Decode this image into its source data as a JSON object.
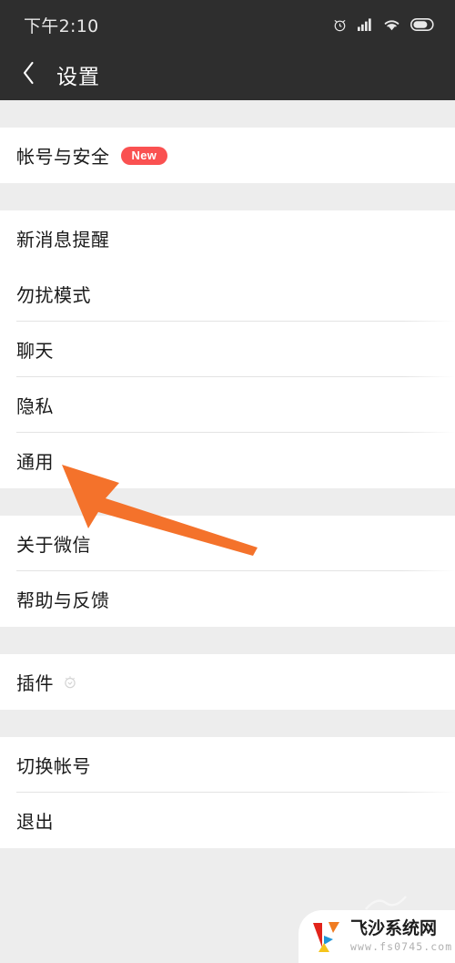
{
  "status_bar": {
    "time": "下午2:10",
    "icons": [
      "alarm-icon",
      "signal-icon",
      "wifi-icon",
      "battery-icon"
    ],
    "background_color": "#2e2e2e",
    "text_color": "#e8e8e8"
  },
  "header": {
    "back_icon": "chevron-left-icon",
    "title": "设置",
    "background_color": "#2e2e2e",
    "title_color": "#ffffff"
  },
  "colors": {
    "page_background": "#ededed",
    "card_background": "#ffffff",
    "divider": "#e3e3e3",
    "badge_red": "#fa5151",
    "annotation_orange": "#f4722b",
    "primary_text": "#1a1a1a"
  },
  "sections": [
    {
      "name": "account-section",
      "rows": [
        {
          "label": "帐号与安全",
          "badge": "New",
          "divider": false
        }
      ]
    },
    {
      "name": "preferences-section",
      "rows": [
        {
          "label": "新消息提醒",
          "divider": false
        },
        {
          "label": "勿扰模式",
          "divider": true
        },
        {
          "label": "聊天",
          "divider": true
        },
        {
          "label": "隐私",
          "divider": true
        },
        {
          "label": "通用",
          "divider": false
        }
      ]
    },
    {
      "name": "info-section",
      "rows": [
        {
          "label": "关于微信",
          "divider": true
        },
        {
          "label": "帮助与反馈",
          "divider": false
        }
      ]
    },
    {
      "name": "plugins-section",
      "rows": [
        {
          "label": "插件",
          "mark": "plugin-badge-icon",
          "divider": false
        }
      ]
    },
    {
      "name": "account-actions-section",
      "rows": [
        {
          "label": "切换帐号",
          "divider": true
        },
        {
          "label": "退出",
          "divider": false
        }
      ]
    }
  ],
  "annotation": {
    "type": "arrow",
    "color": "#f4722b",
    "description": "orange arrow pointing to 通用"
  },
  "watermark": {
    "site_name": "飞沙系统网",
    "url": "www.fs0745.com",
    "logo_colors": [
      "#e2231a",
      "#f07c22",
      "#2196d8",
      "#f5c41b"
    ]
  }
}
